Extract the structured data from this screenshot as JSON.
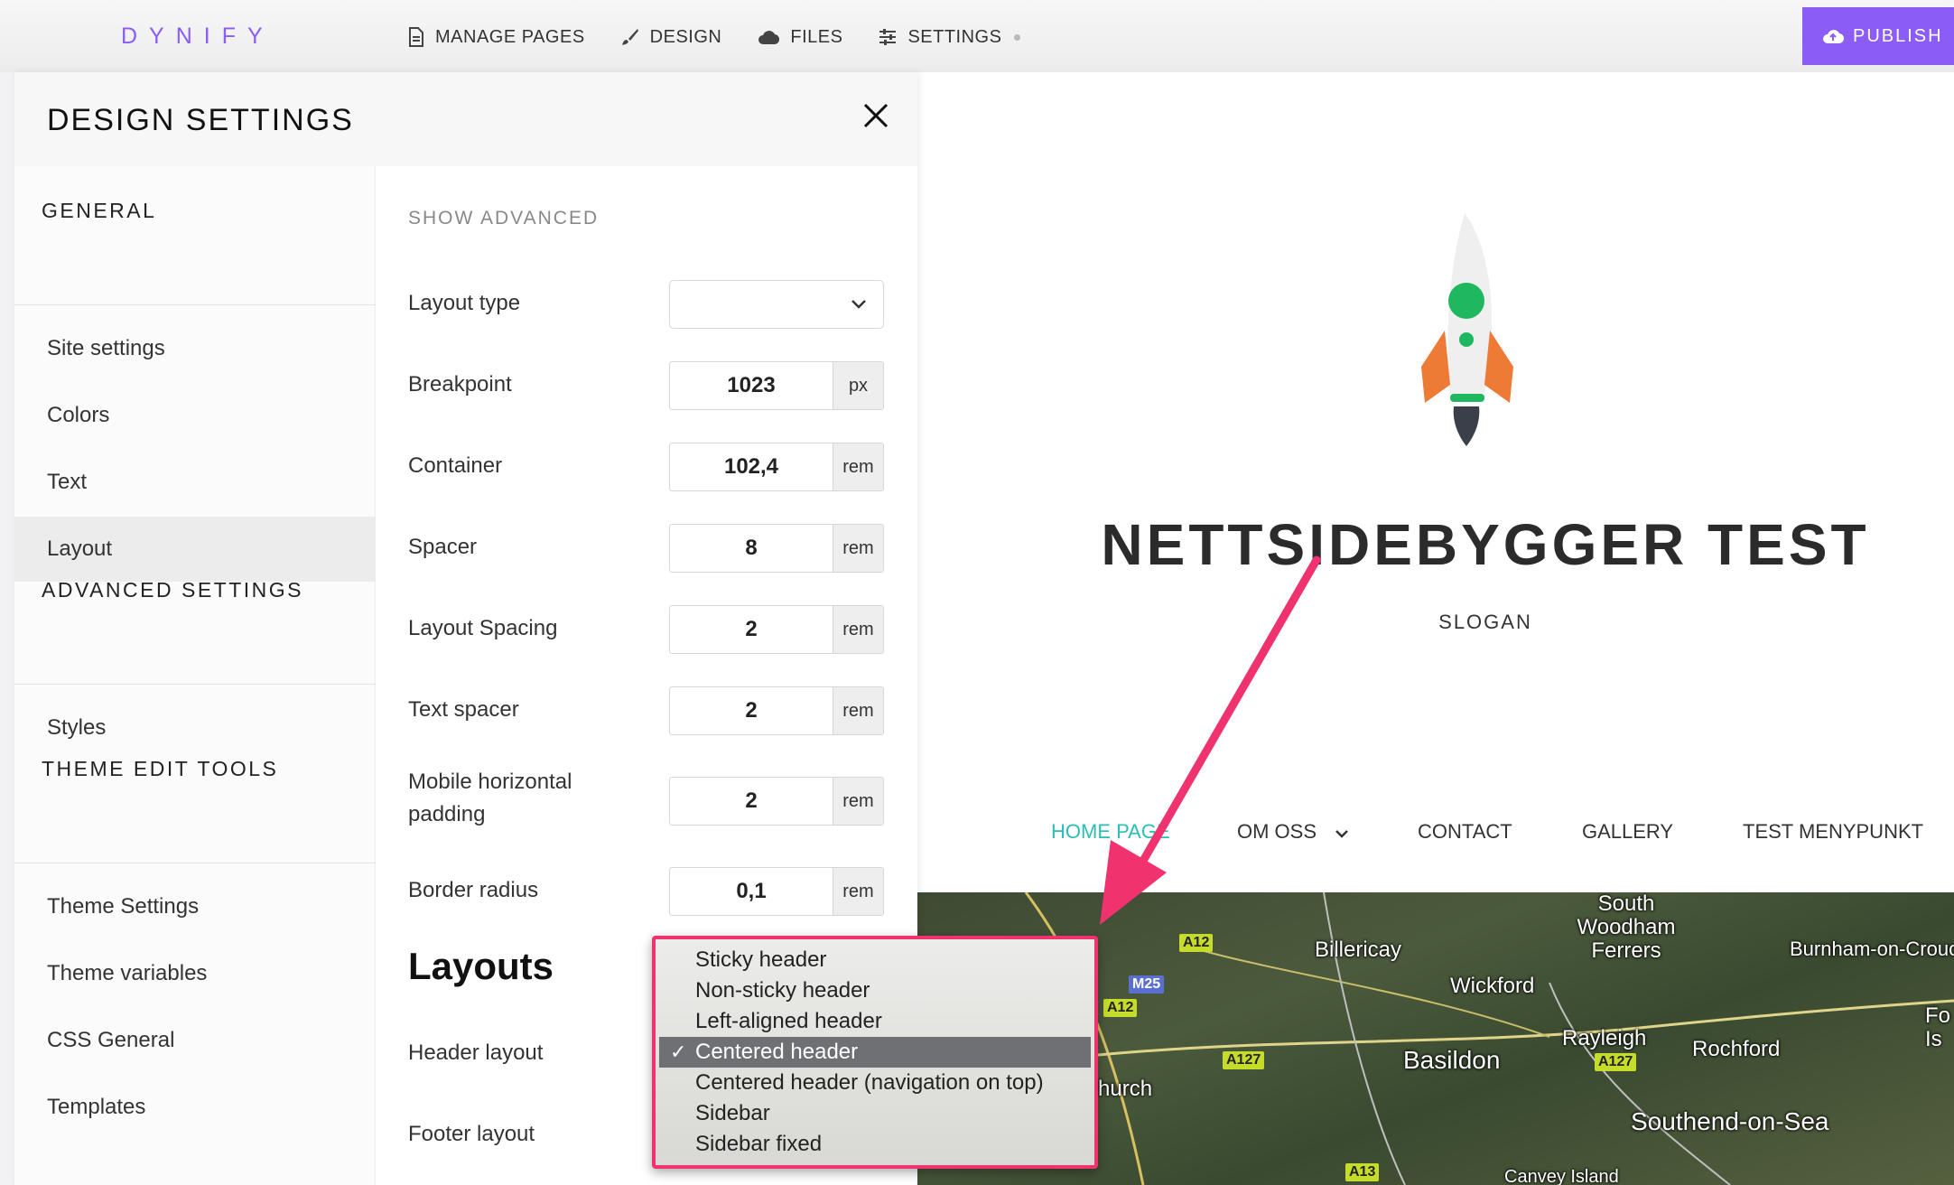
{
  "app": {
    "logo": "DYNIFY",
    "nav": [
      "MANAGE PAGES",
      "DESIGN",
      "FILES",
      "SETTINGS"
    ],
    "publish": "PUBLISH",
    "accent": "#8b5cf6"
  },
  "panel": {
    "title": "DESIGN SETTINGS",
    "sections": [
      {
        "heading": "GENERAL",
        "items": [
          "Site settings",
          "Colors",
          "Text",
          "Layout"
        ]
      },
      {
        "heading": "ADVANCED SETTINGS",
        "items": [
          "Styles"
        ]
      },
      {
        "heading": "THEME EDIT TOOLS",
        "items": [
          "Theme Settings",
          "Theme variables",
          "CSS General",
          "Templates"
        ]
      }
    ],
    "active_item": "Layout",
    "show_advanced": "SHOW ADVANCED",
    "layout_type": {
      "label": "Layout type",
      "value": ""
    },
    "fields": [
      {
        "label": "Breakpoint",
        "value": "1023",
        "unit": "px"
      },
      {
        "label": "Container",
        "value": "102,4",
        "unit": "rem"
      },
      {
        "label": "Spacer",
        "value": "8",
        "unit": "rem"
      },
      {
        "label": "Layout Spacing",
        "value": "2",
        "unit": "rem"
      },
      {
        "label": "Text spacer",
        "value": "2",
        "unit": "rem"
      },
      {
        "label": "Mobile horizontal padding",
        "value": "2",
        "unit": "rem"
      },
      {
        "label": "Border radius",
        "value": "0,1",
        "unit": "rem"
      }
    ],
    "layouts_heading": "Layouts",
    "header_layout": "Header layout",
    "footer_layout": "Footer layout",
    "header_options": [
      "Sticky header",
      "Non-sticky header",
      "Left-aligned header",
      "Centered header",
      "Centered header (navigation on top)",
      "Sidebar",
      "Sidebar fixed"
    ],
    "header_selected": "Centered header"
  },
  "preview": {
    "title": "NETTSIDEBYGGER TEST",
    "slogan": "SLOGAN",
    "nav": [
      "HOME PAGE",
      "OM OSS",
      "CONTACT",
      "GALLERY",
      "TEST MENYPUNKT"
    ],
    "nav_active_color": "#2bbfb3",
    "map_labels": [
      "Billericay",
      "Wickford",
      "South Woodham Ferrers",
      "Burnham-on-Crouch",
      "Rayleigh",
      "Rochford",
      "Basildon",
      "Southend-on-Sea",
      "hurch",
      "Canvey Island",
      "Fo Is"
    ],
    "roads": [
      "A12",
      "M25",
      "A12",
      "A127",
      "A127",
      "A13"
    ]
  }
}
